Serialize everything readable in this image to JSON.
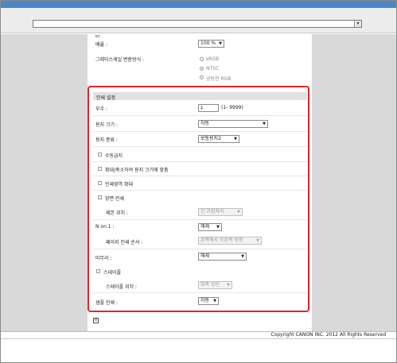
{
  "browser": {
    "address_value": "",
    "dropdown_glyph": "▾"
  },
  "settings": {
    "magnification": {
      "label": "배율 :",
      "value": "100 %"
    },
    "grayscale": {
      "label": "그레이스케일 변환방식 :",
      "options": [
        {
          "label": "sRGB",
          "checked": false
        },
        {
          "label": "NTSC",
          "checked": true
        },
        {
          "label": "균등한 RGB",
          "checked": false
        }
      ]
    }
  },
  "print_settings": {
    "section_title": "인쇄 설정",
    "copies": {
      "label": "부수 :",
      "value": "1",
      "range": "(1- 9999)"
    },
    "paper_size": {
      "label": "용지 크기 :",
      "value": "자동"
    },
    "paper_type": {
      "label": "용지 종류 :",
      "value": "보통용지2"
    },
    "checkboxes": {
      "manual_feed": "수동급지",
      "fit_to_paper": "확대/축소하여 용지 크기에 맞춤",
      "enlarge_print_area": "인쇄영역 확대",
      "duplex": "양면 인쇄"
    },
    "binding_location": {
      "label": "제본 위치 :",
      "value": "긴 가장자리"
    },
    "n_on_1": {
      "label": "N on 1 :",
      "value": "해제"
    },
    "page_order": {
      "label": "페이지 인쇄 순서 :",
      "value": "왼쪽에서 오른쪽 방향"
    },
    "finishing": {
      "label": "마무리 :",
      "value": "해제"
    },
    "staple_checkbox": "스테이플",
    "staple_position": {
      "label": "스테이플 위치 :",
      "value": "좌측 상단"
    },
    "sample_print": {
      "label": "샘플 인쇄 :",
      "value": "자동"
    }
  },
  "footer": {
    "page_icon_glyph": "≡",
    "copyright": "Copyright CANON INC. 2012 All Rights Reserved"
  }
}
